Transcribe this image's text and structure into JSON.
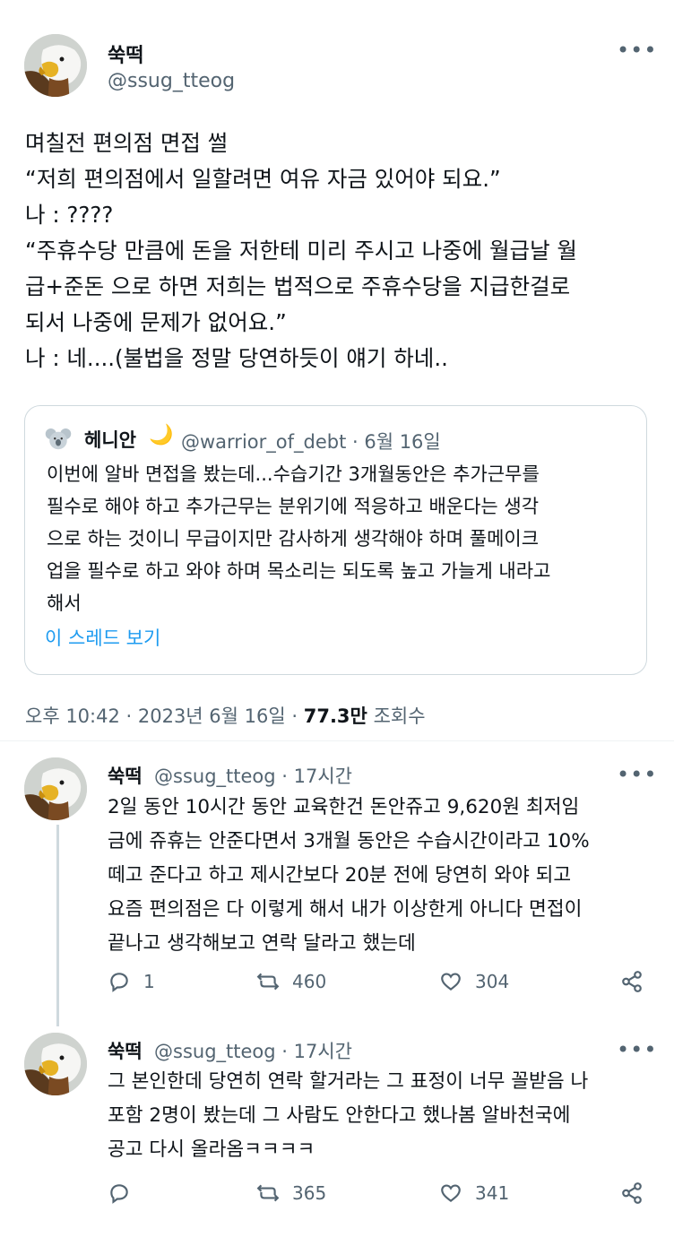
{
  "tweet": {
    "author_name": "쑥떡",
    "author_handle": "@ssug_tteog",
    "text_lines": [
      "며칠전 편의점 면접 썰",
      "“저희 편의점에서 일할려면 여유 자금 있어야 되요.”",
      "나 : ????",
      "“주휴수당 만큼에 돈을 저한테 미리 주시고 나중에 월급날 월",
      "급+준돈 으로 하면 저희는 법적으로 주휴수당을 지급한걸로",
      "되서 나중에 문제가 없어요.”",
      "나 : 네....(불법을 정말 당연하듯이 얘기 하네.."
    ],
    "time": "오후 10:42 · 2023년 6월 16일 ·",
    "views_count": "77.3만",
    "views_label": "조회수"
  },
  "quote": {
    "author_name": "헤니안",
    "author_handle": "@warrior_of_debt · 6월 16일",
    "text_lines": [
      "이번에 알바 면접을 봤는데...수습기간 3개월동안은 추가근무를",
      "필수로 해야 하고 추가근무는 분위기에 적응하고 배운다는 생각",
      "으로 하는 것이니 무급이지만 감사하게 생각해야 하며 풀메이크",
      "업을 필수로 하고 와야 하며 목소리는 되도록 높고 가늘게 내라고",
      "해서"
    ],
    "show_thread": "이 스레드 보기"
  },
  "replies": [
    {
      "author_name": "쑥떡",
      "author_handle": "@ssug_tteog · 17시간",
      "text_lines": [
        "2일 동안 10시간 동안 교육한건 돈안쥬고  9,620원 최저임",
        "금에 쥬휴는 안준다면서 3개월 동안은 수습시간이라고 10%",
        "떼고 준다고 하고 제시간보다 20분 전에 당연히 와야 되고",
        "요즘 편의점은 다 이렇게 해서 내가 이상한게 아니다 면접이",
        "끝나고 생각해보고 연락 달라고 했는데"
      ],
      "replies": "1",
      "retweets": "460",
      "likes": "304"
    },
    {
      "author_name": "쑥떡",
      "author_handle": "@ssug_tteog · 17시간",
      "text_lines": [
        "그 본인한데 당연히 연락 할거라는 그 표정이 너무 꼴받음 나",
        "포함 2명이 봤는데 그 사람도 안한다고 했나봄 알바천국에",
        "공고 다시 올라옴ㅋㅋㅋㅋ"
      ],
      "replies": "",
      "retweets": "365",
      "likes": "341"
    }
  ],
  "icons": {
    "more": "more-horizontal-icon",
    "reply": "reply-icon",
    "retweet": "retweet-icon",
    "like": "heart-icon",
    "share": "share-icon",
    "moon": "crescent-moon-icon"
  },
  "colors": {
    "link": "#1d9bf0",
    "secondary_text": "#536471",
    "border": "#cfd9de"
  }
}
